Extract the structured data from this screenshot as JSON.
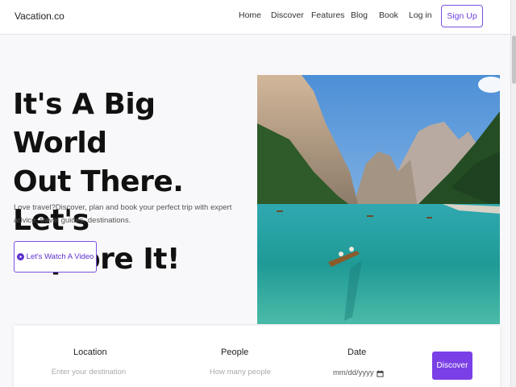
{
  "nav": {
    "brand": "Vacation.co",
    "links": [
      "Home",
      "Discover",
      "Features",
      "Blog",
      "Book",
      "Log in"
    ],
    "signup": "Sign Up"
  },
  "hero": {
    "title_lines": [
      "It's A Big World",
      "Out There. Let's",
      "Explore It!"
    ],
    "subtitle": "Love travel?Discover, plan and book your perfect trip with expert advice, travel guides, destinations.",
    "video_button": "Let's Watch A Video",
    "play_icon": "play-circle-icon",
    "image": "mountain-lake-boat-photo"
  },
  "search": {
    "location_label": "Location",
    "location_placeholder": "Enter your destination",
    "people_label": "People",
    "people_placeholder": "How many people",
    "date_label": "Date",
    "date_placeholder": "mm/dd/yyyy",
    "discover_button": "Discover"
  },
  "colors": {
    "accent": "#7a3fe6",
    "text_dark": "#111111"
  }
}
